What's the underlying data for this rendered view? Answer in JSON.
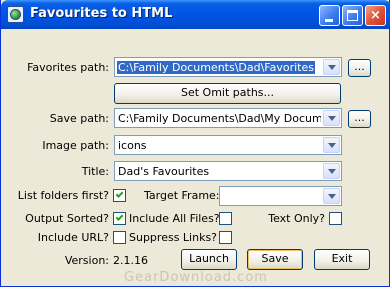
{
  "window": {
    "title": "Favourites to HTML",
    "buttons": {
      "minimize": "minimize",
      "maximize": "maximize",
      "close": "×"
    }
  },
  "form": {
    "favorites_path": {
      "label": "Favorites path:",
      "value": "C:\\Family Documents\\Dad\\Favorites",
      "browse": "..."
    },
    "set_omit": "Set Omit paths...",
    "save_path": {
      "label": "Save path:",
      "value": "C:\\Family Documents\\Dad\\My Documents",
      "browse": "..."
    },
    "image_path": {
      "label": "Image path:",
      "value": "icons"
    },
    "title": {
      "label": "Title:",
      "value": "Dad's Favourites"
    },
    "list_folders_first": {
      "label": "List folders first?",
      "checked": true
    },
    "target_frame": {
      "label": "Target Frame:",
      "value": ""
    },
    "output_sorted": {
      "label": "Output Sorted?",
      "checked": true
    },
    "include_all_files": {
      "label": "Include All Files?",
      "checked": false
    },
    "text_only": {
      "label": "Text Only?",
      "checked": false
    },
    "include_url": {
      "label": "Include URL?",
      "checked": false
    },
    "suppress_links": {
      "label": "Suppress Links?",
      "checked": false
    },
    "version_label": "Version:",
    "version_value": "2.1.16",
    "launch": "Launch",
    "save": "Save",
    "exit": "Exit"
  },
  "watermark": "GearDownload.com"
}
